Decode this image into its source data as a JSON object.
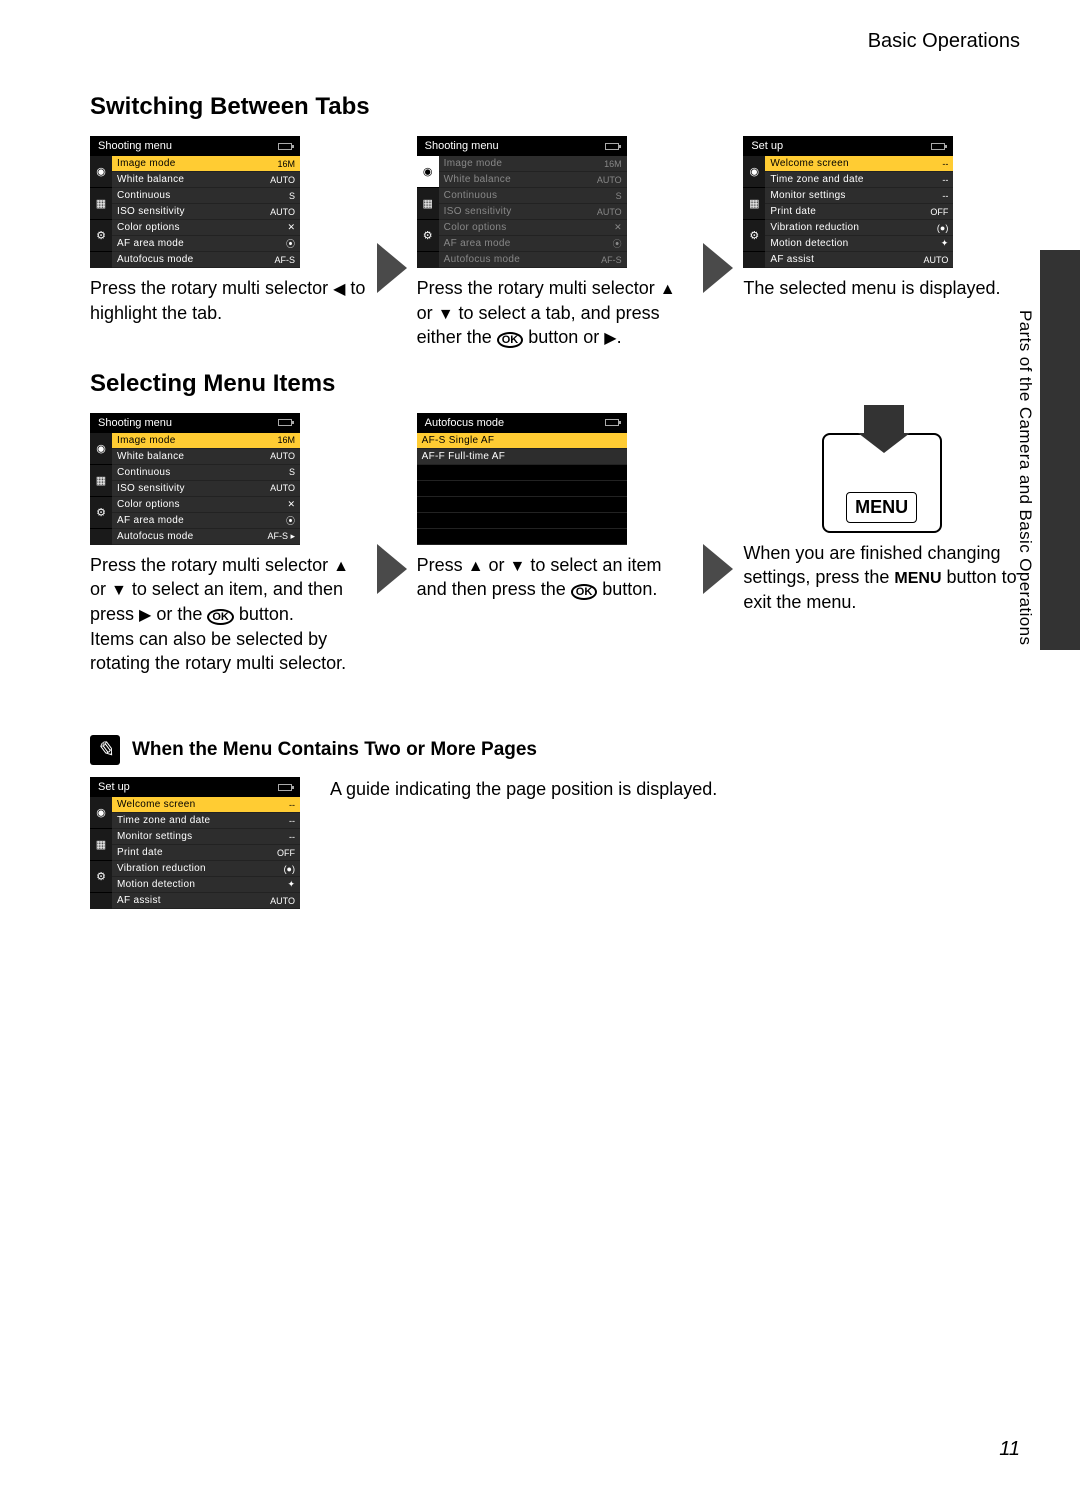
{
  "header": {
    "category": "Basic Operations"
  },
  "vertical_label": "Parts of the Camera and Basic Operations",
  "page_number": "11",
  "section1": {
    "title": "Switching Between Tabs",
    "panels": [
      {
        "menu_title": "Shooting menu",
        "highlight_index": 0,
        "items": [
          {
            "label": "Image mode",
            "value": "16M"
          },
          {
            "label": "White balance",
            "value": "AUTO"
          },
          {
            "label": "Continuous",
            "value": "S"
          },
          {
            "label": "ISO sensitivity",
            "value": "AUTO"
          },
          {
            "label": "Color options",
            "value": "✕"
          },
          {
            "label": "AF area mode",
            "value": "⦿"
          },
          {
            "label": "Autofocus mode",
            "value": "AF-S"
          }
        ],
        "caption_parts": [
          "Press the rotary multi selector ",
          "◀",
          " to highlight the tab."
        ]
      },
      {
        "menu_title": "Shooting menu",
        "tabs_selected": true,
        "dimmed": true,
        "items": [
          {
            "label": "Image mode",
            "value": "16M"
          },
          {
            "label": "White balance",
            "value": "AUTO"
          },
          {
            "label": "Continuous",
            "value": "S"
          },
          {
            "label": "ISO sensitivity",
            "value": "AUTO"
          },
          {
            "label": "Color options",
            "value": "✕"
          },
          {
            "label": "AF area mode",
            "value": "⦿"
          },
          {
            "label": "Autofocus mode",
            "value": "AF-S"
          }
        ],
        "caption_parts": [
          "Press the rotary multi selector ",
          "▲",
          " or ",
          "▼",
          " to select a tab, and press either the ",
          "OK",
          " button or ",
          "▶",
          "."
        ]
      },
      {
        "menu_title": "Set up",
        "highlight_index": 0,
        "items": [
          {
            "label": "Welcome screen",
            "value": "--"
          },
          {
            "label": "Time zone and date",
            "value": "--"
          },
          {
            "label": "Monitor settings",
            "value": "--"
          },
          {
            "label": "Print date",
            "value": "OFF"
          },
          {
            "label": "Vibration reduction",
            "value": "(●)"
          },
          {
            "label": "Motion detection",
            "value": "✦"
          },
          {
            "label": "AF assist",
            "value": "AUTO"
          }
        ],
        "caption_parts": [
          "The selected menu is displayed."
        ]
      }
    ]
  },
  "section2": {
    "title": "Selecting Menu Items",
    "panels": [
      {
        "menu_title": "Shooting menu",
        "highlight_index": 0,
        "highlight_last_arrow": true,
        "items": [
          {
            "label": "Image mode",
            "value": "16M"
          },
          {
            "label": "White balance",
            "value": "AUTO"
          },
          {
            "label": "Continuous",
            "value": "S"
          },
          {
            "label": "ISO sensitivity",
            "value": "AUTO"
          },
          {
            "label": "Color options",
            "value": "✕"
          },
          {
            "label": "AF area mode",
            "value": "⦿"
          },
          {
            "label": "Autofocus mode",
            "value": "AF-S ▸"
          }
        ],
        "caption_parts": [
          "Press the rotary multi selector ",
          "▲",
          " or ",
          "▼",
          " to select an item, and then press ",
          "▶",
          " or the ",
          "OK",
          " button.\nItems can also be selected by rotating the rotary multi selector."
        ]
      },
      {
        "menu_title": "Autofocus mode",
        "no_tabs": true,
        "highlight_index": 0,
        "items": [
          {
            "label": "AF-S  Single AF",
            "value": ""
          },
          {
            "label": "AF-F  Full-time AF",
            "value": ""
          }
        ],
        "caption_parts": [
          "Press ",
          "▲",
          " or ",
          "▼",
          " to select an item and then press the ",
          "OK",
          " button."
        ]
      },
      {
        "menu_button_label": "MENU",
        "caption_parts": [
          "When you are finished changing settings, press the ",
          "MENU",
          " button to exit the menu."
        ]
      }
    ]
  },
  "note": {
    "title": "When the Menu Contains Two or More Pages",
    "caption": "A guide indicating the page position is displayed.",
    "panel": {
      "menu_title": "Set up",
      "highlight_index": 0,
      "items": [
        {
          "label": "Welcome screen",
          "value": "--"
        },
        {
          "label": "Time zone and date",
          "value": "--"
        },
        {
          "label": "Monitor settings",
          "value": "--"
        },
        {
          "label": "Print date",
          "value": "OFF"
        },
        {
          "label": "Vibration reduction",
          "value": "(●)"
        },
        {
          "label": "Motion detection",
          "value": "✦"
        },
        {
          "label": "AF assist",
          "value": "AUTO"
        }
      ]
    }
  }
}
